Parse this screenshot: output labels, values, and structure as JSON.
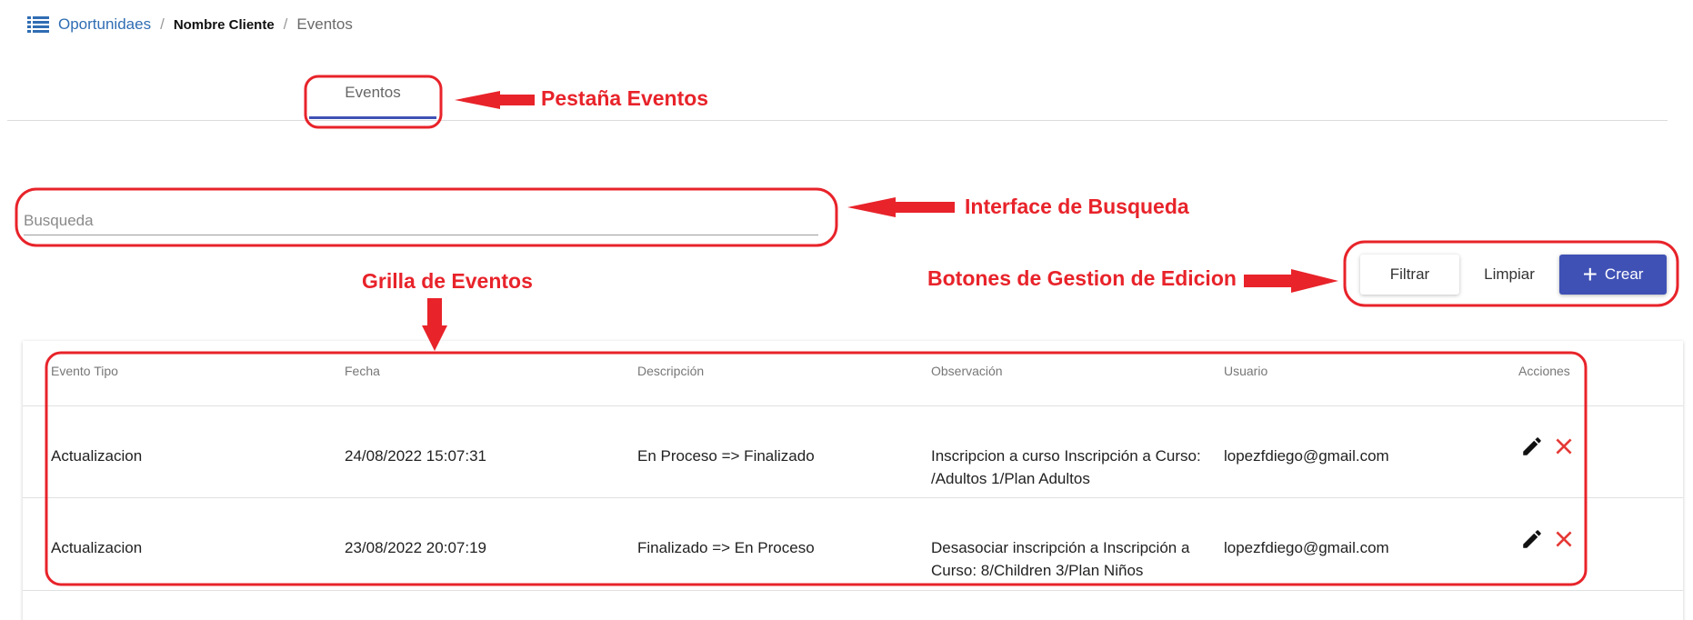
{
  "breadcrumb": {
    "items": [
      "Oportunidaes",
      "Nombre Cliente",
      "Eventos"
    ],
    "separator": "/"
  },
  "tabs": [
    {
      "label": "Eventos",
      "active": true
    }
  ],
  "search": {
    "placeholder": "Busqueda",
    "value": ""
  },
  "buttons": {
    "filtrar": "Filtrar",
    "limpiar": "Limpiar",
    "crear": "Crear"
  },
  "grid": {
    "columns": [
      "Evento Tipo",
      "Fecha",
      "Descripción",
      "Observación",
      "Usuario",
      "Acciones"
    ],
    "rows": [
      {
        "tipo": "Actualizacion",
        "fecha": "24/08/2022 15:07:31",
        "descripcion": "En Proceso => Finalizado",
        "observacion_1": "Inscripcion a curso Inscripción a Curso:",
        "observacion_2": "/Adultos 1/Plan Adultos",
        "usuario": "lopezfdiego@gmail.com"
      },
      {
        "tipo": "Actualizacion",
        "fecha": "23/08/2022 20:07:19",
        "descripcion": "Finalizado => En Proceso",
        "observacion_1": "Desasociar inscripción a Inscripción a",
        "observacion_2": "Curso: 8/Children 3/Plan Niños",
        "usuario": "lopezfdiego@gmail.com"
      }
    ]
  },
  "annotations": {
    "tab": "Pestaña Eventos",
    "search": "Interface de Busqueda",
    "grid": "Grilla de Eventos",
    "buttons": "Botones de Gestion de Edicion"
  },
  "icons": [
    "list-icon",
    "plus-icon",
    "edit-icon",
    "delete-icon"
  ],
  "colors": {
    "accent": "#3f51b5",
    "link": "#2f6db3",
    "annotation": "#e8232a",
    "delete": "#e53935"
  }
}
